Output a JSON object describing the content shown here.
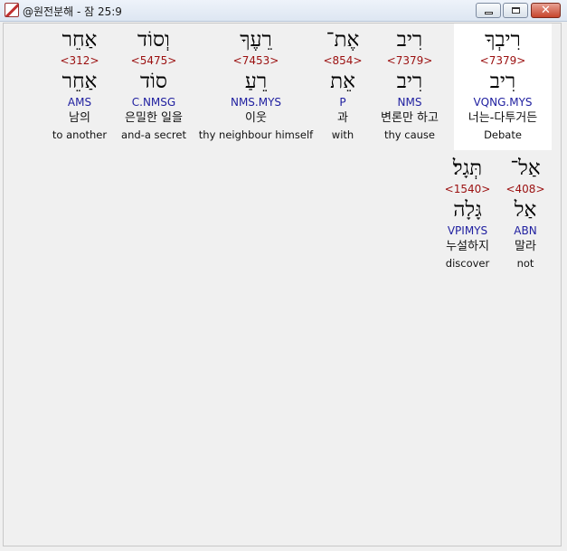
{
  "window": {
    "title": "@원전분해 - 잠 25:9",
    "app_icon": "bible-app-icon"
  },
  "words": [
    {
      "hebrew": "רִיבְךָ",
      "strong": "<7379>",
      "lemma": "רִיב",
      "morph": "VQNG.MYS",
      "korean": "너는-다투거든",
      "english": "Debate",
      "selected": true
    },
    {
      "hebrew": "רִיב",
      "strong": "<7379>",
      "lemma": "רִיב",
      "morph": "NMS",
      "korean": "변론만 하고",
      "english": "thy cause",
      "selected": false
    },
    {
      "hebrew": "אֶת־",
      "strong": "<854>",
      "lemma": "אֵת",
      "morph": "P",
      "korean": "과",
      "english": "with",
      "selected": false
    },
    {
      "hebrew": "רֵעֶךָ",
      "strong": "<7453>",
      "lemma": "רֵעַ",
      "morph": "NMS.MYS",
      "korean": "이웃",
      "english": "thy neighbour himself",
      "selected": false
    },
    {
      "hebrew": "וְסוֹד",
      "strong": "<5475>",
      "lemma": "סוֹד",
      "morph": "C.NMSG",
      "korean": "은밀한 일을",
      "english": "and-a secret",
      "selected": false
    },
    {
      "hebrew": "אַחֵר",
      "strong": "<312>",
      "lemma": "אַחֵר",
      "morph": "AMS",
      "korean": "남의",
      "english": "to another",
      "selected": false
    },
    {
      "hebrew": "אַל־",
      "strong": "<408>",
      "lemma": "אַל",
      "morph": "ABN",
      "korean": "말라",
      "english": "not",
      "selected": false
    },
    {
      "hebrew": "תְּגָל׃",
      "strong": "<1540>",
      "lemma": "גָּלָה",
      "morph": "VPIMYS",
      "korean": "누설하지",
      "english": "discover",
      "selected": false
    }
  ]
}
